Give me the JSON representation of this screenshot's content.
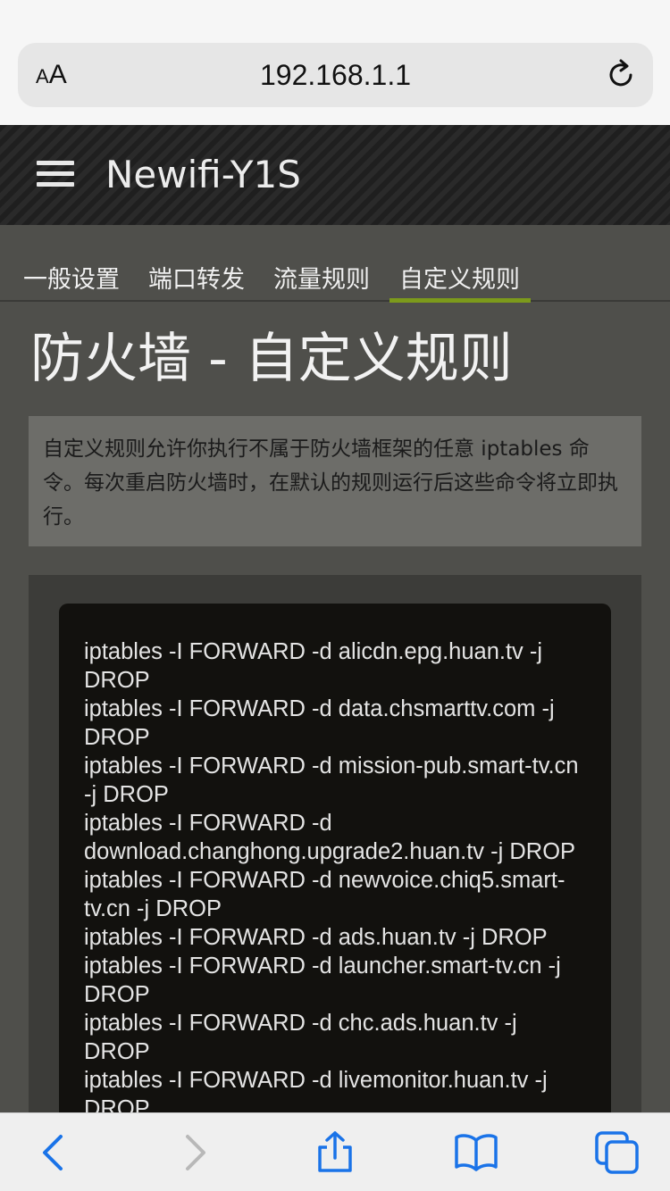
{
  "browser": {
    "aa_small": "A",
    "aa_large": "A",
    "url": "192.168.1.1"
  },
  "site": {
    "brand": "Newifi-Y1S"
  },
  "tabs": [
    {
      "label": "一般设置"
    },
    {
      "label": "端口转发"
    },
    {
      "label": "流量规则"
    },
    {
      "label": "自定义规则",
      "active": true
    }
  ],
  "page": {
    "title": "防火墙 - 自定义规则",
    "description": "自定义规则允许你执行不属于防火墙框架的任意 iptables 命令。每次重启防火墙时，在默认的规则运行后这些命令将立即执行。"
  },
  "editor": {
    "lines": [
      "iptables -I FORWARD -d alicdn.epg.huan.tv -j DROP",
      "iptables -I FORWARD -d data.chsmarttv.com -j DROP",
      "iptables -I FORWARD -d mission-pub.smart-tv.cn -j DROP",
      "iptables -I FORWARD -d download.changhong.upgrade2.huan.tv -j DROP",
      "iptables -I FORWARD -d newvoice.chiq5.smart-tv.cn -j DROP",
      "iptables -I FORWARD -d ads.huan.tv -j DROP",
      "iptables -I FORWARD -d launcher.smart-tv.cn -j DROP",
      "iptables -I FORWARD -d chc.ads.huan.tv -j DROP",
      "iptables -I FORWARD -d livemonitor.huan.tv -j DROP"
    ]
  },
  "colors": {
    "accent": "#7c9a1b",
    "ios_blue": "#1a73e8"
  }
}
